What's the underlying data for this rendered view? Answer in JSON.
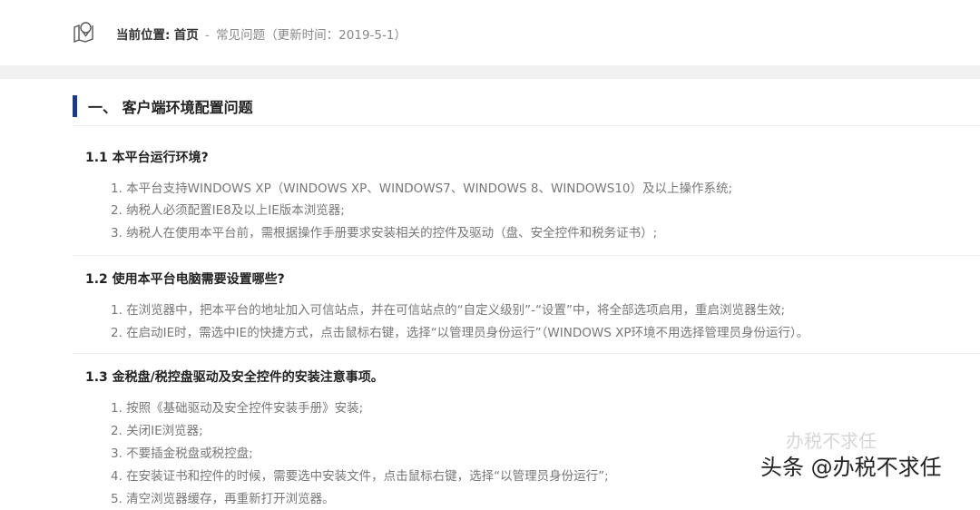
{
  "breadcrumb": {
    "label": "当前位置:",
    "home": "首页",
    "separator": "-",
    "current": "常见问题（更新时间：2019-5-1）"
  },
  "section": {
    "title": "一、 客户端环境配置问题"
  },
  "faqs": [
    {
      "question": "1.1 本平台运行环境?",
      "answers": [
        "1. 本平台支持WINDOWS XP（WINDOWS XP、WINDOWS7、WINDOWS 8、WINDOWS10）及以上操作系统;",
        "2. 纳税人必须配置IE8及以上IE版本浏览器;",
        "3. 纳税人在使用本平台前，需根据操作手册要求安装相关的控件及驱动（盘、安全控件和税务证书）;"
      ]
    },
    {
      "question": "1.2 使用本平台电脑需要设置哪些?",
      "answers": [
        "1. 在浏览器中，把本平台的地址加入可信站点，并在可信站点的“自定义级别”-“设置”中，将全部选项启用，重启浏览器生效;",
        "2. 在启动IE时，需选中IE的快捷方式，点击鼠标右键，选择“以管理员身份运行”（WINDOWS XP环境不用选择管理员身份运行）。"
      ]
    },
    {
      "question": "1.3 金税盘/税控盘驱动及安全控件的安装注意事项。",
      "answers": [
        "1. 按照《基础驱动及安全控件安装手册》安装;",
        "2. 关闭IE浏览器;",
        "3. 不要插金税盘或税控盘;",
        "4. 在安装证书和控件的时候，需要选中安装文件，点击鼠标右键，选择“以管理员身份运行”;",
        "5. 清空浏览器缓存，再重新打开浏览器。"
      ]
    }
  ],
  "watermark": {
    "main": "头条 @办税不求任",
    "faint": "办税不求任"
  },
  "icons": {
    "location": "map-pin-icon"
  },
  "colors": {
    "accent": "#1c3a7e",
    "band": "#f1f1f1"
  }
}
